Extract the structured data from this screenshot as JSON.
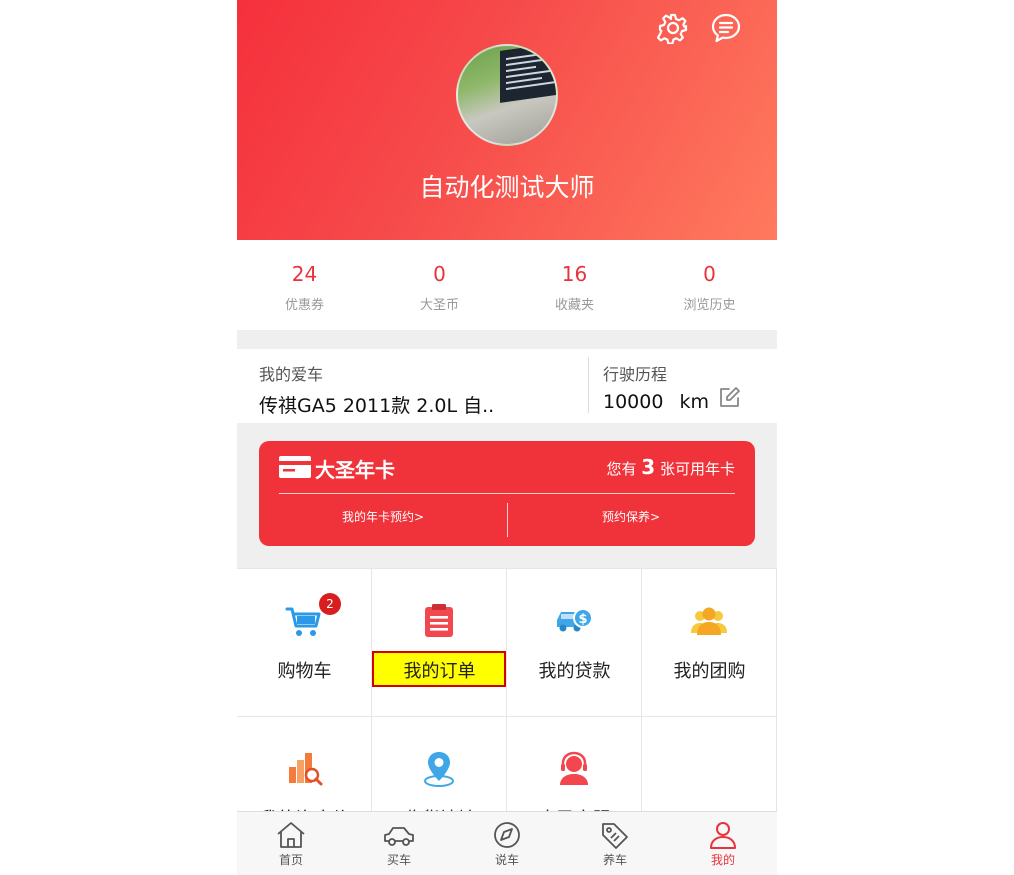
{
  "header": {
    "username": "自动化测试大师",
    "settings_icon": "gear-icon",
    "messages_icon": "chat-bubble-icon",
    "avatar_icon": "avatar-photo",
    "gradient_colors": [
      "#f5303c",
      "#ff7a5e"
    ]
  },
  "stats": [
    {
      "value": "24",
      "label": "优惠券"
    },
    {
      "value": "0",
      "label": "大圣币"
    },
    {
      "value": "16",
      "label": "收藏夹"
    },
    {
      "value": "0",
      "label": "浏览历史"
    }
  ],
  "car": {
    "my_car_label": "我的爱车",
    "my_car_value": "传祺GA5 2011款 2.0L 自..",
    "mileage_label": "行驶历程",
    "mileage_value": "10000",
    "mileage_unit": "km",
    "edit_icon": "edit-icon"
  },
  "year_card": {
    "title": "大圣年卡",
    "available_prefix": "您有",
    "available_count": "3",
    "available_suffix": "张可用年卡",
    "link_reserve_card": "我的年卡预约>",
    "link_reserve_maintenance": "预约保养>",
    "card_color": "#f0323a"
  },
  "grid": {
    "items": [
      {
        "label": "购物车",
        "icon": "shopping-cart-icon",
        "badge": "2"
      },
      {
        "label": "我的订单",
        "icon": "clipboard-icon",
        "highlighted": true
      },
      {
        "label": "我的贷款",
        "icon": "car-loan-icon"
      },
      {
        "label": "我的团购",
        "icon": "group-icon"
      },
      {
        "label": "我的询底价",
        "icon": "chart-search-icon"
      },
      {
        "label": "收货地址",
        "icon": "location-pin-icon"
      },
      {
        "label": "大圣客服",
        "icon": "customer-service-icon"
      }
    ]
  },
  "tabbar": {
    "tabs": [
      {
        "label": "首页",
        "icon": "home-icon"
      },
      {
        "label": "买车",
        "icon": "car-icon"
      },
      {
        "label": "说车",
        "icon": "compass-icon"
      },
      {
        "label": "养车",
        "icon": "tag-icon"
      },
      {
        "label": "我的",
        "icon": "person-icon",
        "active": true
      }
    ],
    "active_color": "#e8333c"
  }
}
